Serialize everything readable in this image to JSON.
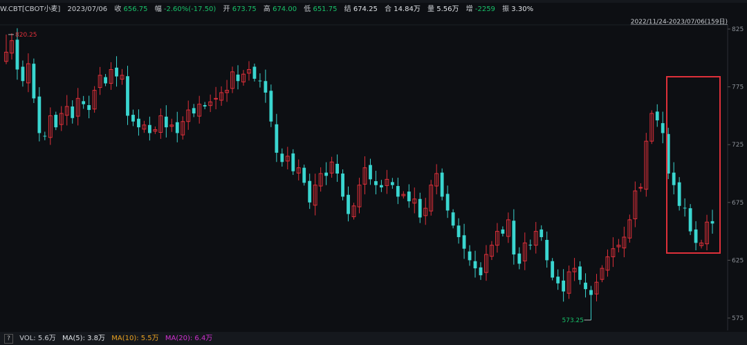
{
  "info": {
    "symbol": "W.CBT[CBOT小麦]",
    "date": "2023/07/06",
    "close_label": "收",
    "close": "656.75",
    "change_label": "幅",
    "change": "-2.60%(-17.50)",
    "open_label": "开",
    "open": "673.75",
    "high_label": "高",
    "high": "674.00",
    "low_label": "低",
    "low": "651.75",
    "settle_label": "结",
    "settle": "674.25",
    "oi_label": "合",
    "oi": "14.84万",
    "volume_label": "量",
    "volume": "5.56万",
    "oichg_label": "增",
    "oichg": "-2259",
    "amp_label": "振",
    "amp": "3.30%"
  },
  "date_range": "2022/11/24-2023/07/06(159日)",
  "volume_bar": {
    "help": "?",
    "vol": "VOL: 5.6万",
    "ma5": "MA(5): 3.8万",
    "ma10": "MA(10): 5.5万",
    "ma20": "MA(20): 6.4万"
  },
  "colors": {
    "up": "#e0303a",
    "down": "#3ad6d0",
    "background": "#0d0f13",
    "highlight_box": "#e0303a"
  },
  "chart_data": {
    "type": "candlestick",
    "ylim": [
      560,
      825
    ],
    "y_ticks": [
      825,
      775,
      725,
      675,
      625,
      575
    ],
    "annotations": {
      "high": "820.25",
      "low": "573.25"
    },
    "highlight_region": "last 14 sessions",
    "closes": [
      805,
      815,
      790,
      780,
      795,
      765,
      735,
      732,
      750,
      740,
      752,
      758,
      748,
      765,
      760,
      755,
      772,
      785,
      778,
      790,
      784,
      785,
      750,
      745,
      740,
      742,
      735,
      738,
      750,
      740,
      742,
      735,
      745,
      755,
      752,
      760,
      758,
      762,
      765,
      770,
      772,
      788,
      780,
      786,
      790,
      782,
      780,
      770,
      745,
      718,
      710,
      715,
      702,
      705,
      692,
      675,
      690,
      700,
      698,
      710,
      700,
      680,
      665,
      672,
      690,
      705,
      695,
      690,
      688,
      695,
      690,
      680,
      682,
      676,
      678,
      662,
      670,
      690,
      700,
      680,
      668,
      655,
      645,
      635,
      625,
      618,
      612,
      630,
      638,
      650,
      648,
      660,
      630,
      622,
      640,
      638,
      650,
      645,
      625,
      610,
      605,
      598,
      615,
      618,
      608,
      600,
      595,
      606,
      618,
      628,
      635,
      638,
      645,
      660,
      685,
      688,
      728,
      752,
      746,
      735,
      700,
      690,
      672,
      670,
      650,
      640,
      640,
      658,
      656.75
    ]
  }
}
